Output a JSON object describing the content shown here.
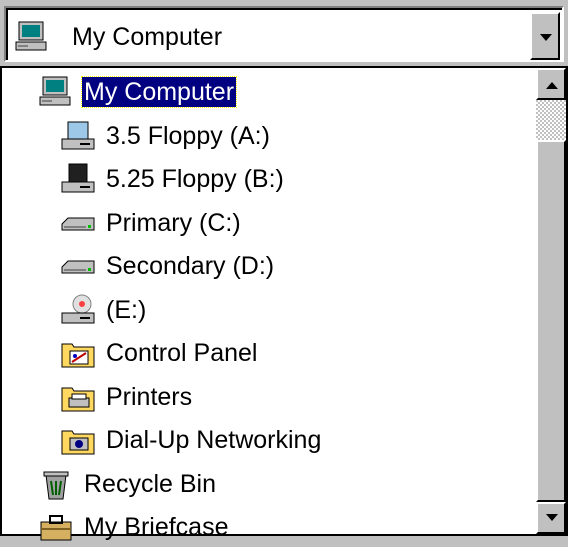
{
  "combo": {
    "value": "My Computer",
    "icon": "my-computer-icon"
  },
  "tree": [
    {
      "label": "My Computer",
      "icon": "my-computer-icon",
      "level": 1,
      "selected": true
    },
    {
      "label": "3.5 Floppy (A:)",
      "icon": "floppy-35-icon",
      "level": 2
    },
    {
      "label": "5.25 Floppy (B:)",
      "icon": "floppy-525-icon",
      "level": 2
    },
    {
      "label": "Primary (C:)",
      "icon": "hard-drive-icon",
      "level": 2
    },
    {
      "label": "Secondary (D:)",
      "icon": "hard-drive-icon",
      "level": 2
    },
    {
      "label": "(E:)",
      "icon": "cd-drive-icon",
      "level": 2
    },
    {
      "label": "Control Panel",
      "icon": "control-panel-folder-icon",
      "level": 2
    },
    {
      "label": "Printers",
      "icon": "printers-folder-icon",
      "level": 2
    },
    {
      "label": "Dial-Up Networking",
      "icon": "dialup-networking-folder-icon",
      "level": 2
    },
    {
      "label": "Recycle Bin",
      "icon": "recycle-bin-icon",
      "level": 1
    },
    {
      "label": "My Briefcase",
      "icon": "briefcase-icon",
      "level": 1
    }
  ],
  "scrollbar": {
    "thumb_start_fraction": 0.0,
    "visible_fraction": 0.1
  }
}
